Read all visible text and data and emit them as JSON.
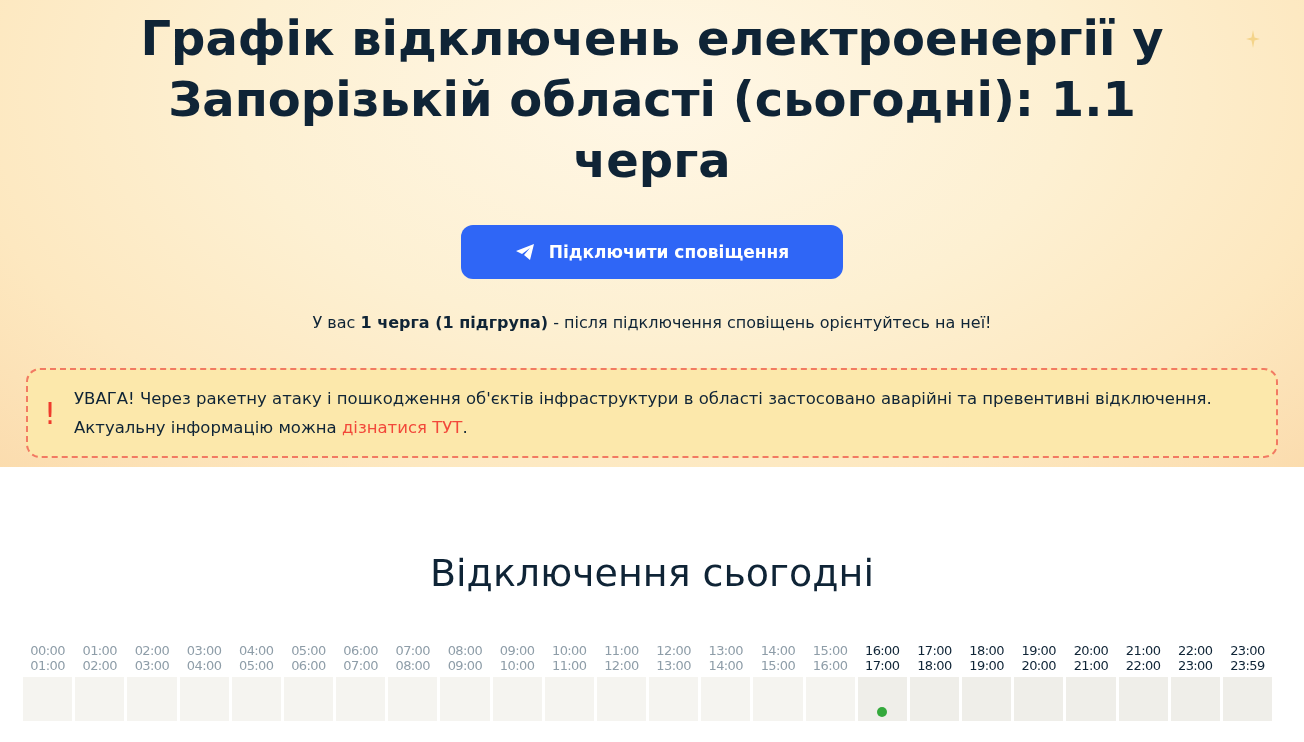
{
  "header": {
    "title": "Графік відключень електроенергії у Запорізькій області (сьогодні): 1.1 черга",
    "button": "Підключити сповіщення",
    "note": "У вас **1 черга (1 підгрупа)** - після підключення сповіщень орієнтуйтесь на неї!"
  },
  "alert": {
    "mark": "!",
    "text": "УВАГА! Через ракетну атаку і пошкодження об'єктів інфраструктури в області застосовано аварійні та превентивні відключення. Актуальну інформацію можна ",
    "link": "дізнатися ТУТ",
    "tail": "."
  },
  "schedule": {
    "title": "Відключення сьогодні",
    "slots": [
      {
        "from": "00:00",
        "to": "01:00",
        "kind": "past"
      },
      {
        "from": "01:00",
        "to": "02:00",
        "kind": "past"
      },
      {
        "from": "02:00",
        "to": "03:00",
        "kind": "past"
      },
      {
        "from": "03:00",
        "to": "04:00",
        "kind": "past"
      },
      {
        "from": "04:00",
        "to": "05:00",
        "kind": "past"
      },
      {
        "from": "05:00",
        "to": "06:00",
        "kind": "past"
      },
      {
        "from": "06:00",
        "to": "07:00",
        "kind": "past"
      },
      {
        "from": "07:00",
        "to": "08:00",
        "kind": "past"
      },
      {
        "from": "08:00",
        "to": "09:00",
        "kind": "past"
      },
      {
        "from": "09:00",
        "to": "10:00",
        "kind": "past"
      },
      {
        "from": "10:00",
        "to": "11:00",
        "kind": "past"
      },
      {
        "from": "11:00",
        "to": "12:00",
        "kind": "past"
      },
      {
        "from": "12:00",
        "to": "13:00",
        "kind": "past"
      },
      {
        "from": "13:00",
        "to": "14:00",
        "kind": "past"
      },
      {
        "from": "14:00",
        "to": "15:00",
        "kind": "past"
      },
      {
        "from": "15:00",
        "to": "16:00",
        "kind": "past"
      },
      {
        "from": "16:00",
        "to": "17:00",
        "kind": "current"
      },
      {
        "from": "17:00",
        "to": "18:00",
        "kind": "future"
      },
      {
        "from": "18:00",
        "to": "19:00",
        "kind": "future"
      },
      {
        "from": "19:00",
        "to": "20:00",
        "kind": "future"
      },
      {
        "from": "20:00",
        "to": "21:00",
        "kind": "future"
      },
      {
        "from": "21:00",
        "to": "22:00",
        "kind": "future"
      },
      {
        "from": "22:00",
        "to": "23:00",
        "kind": "future"
      },
      {
        "from": "23:00",
        "to": "23:59",
        "kind": "future"
      }
    ]
  }
}
